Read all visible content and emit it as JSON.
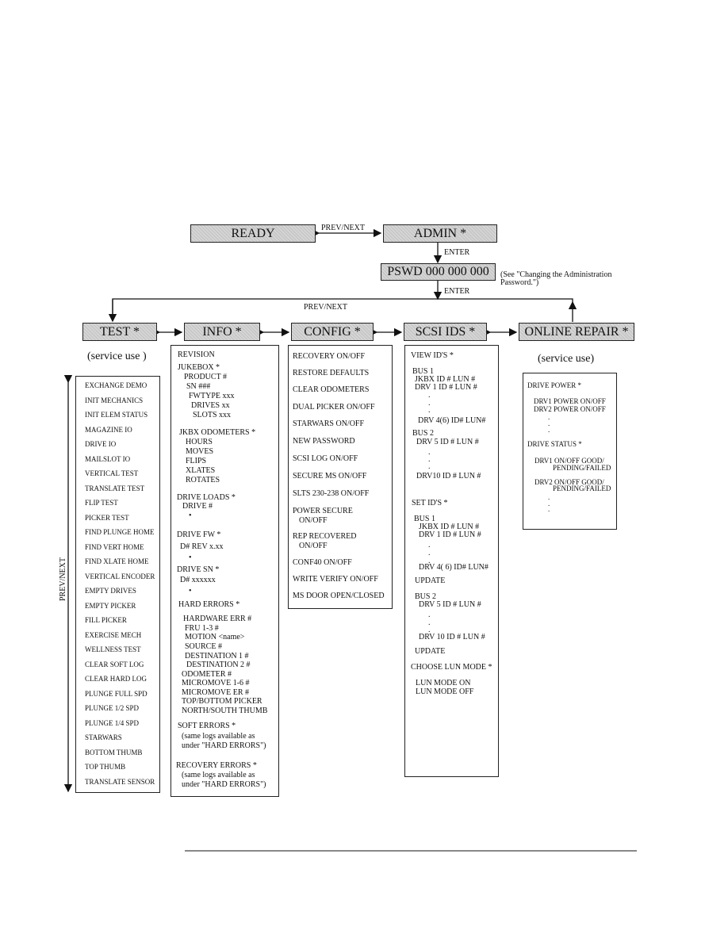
{
  "top": {
    "ready": "READY",
    "admin": "ADMIN *",
    "prev_next_top": "PREV/NEXT",
    "enter_1": "ENTER",
    "pswd": "PSWD 000 000 000",
    "pswd_note_1": "(See \"Changing the Administration",
    "pswd_note_2": "Password.\")",
    "enter_2": "ENTER",
    "prev_next_row": "PREV/NEXT",
    "prev_next_side": "PREV/NEXT"
  },
  "menus": {
    "test": "TEST *",
    "info": "INFO *",
    "config": "CONFIG *",
    "scsi": "SCSI IDS *",
    "online": "ONLINE REPAIR *"
  },
  "test_note": "(service use )",
  "online_note": "(service use)",
  "test_items": [
    "EXCHANGE DEMO",
    "INIT MECHANICS",
    "INIT ELEM STATUS",
    "MAGAZINE IO",
    "DRIVE IO",
    "MAILSLOT IO",
    "VERTICAL TEST",
    "TRANSLATE TEST",
    "FLIP TEST",
    "PICKER TEST",
    "FIND PLUNGE HOME",
    "FIND VERT HOME",
    "FIND XLATE HOME",
    "VERTICAL ENCODER",
    "EMPTY DRIVES",
    "EMPTY  PICKER",
    "FILL PICKER",
    "EXERCISE MECH",
    "WELLNESS TEST",
    "CLEAR SOFT LOG",
    "CLEAR HARD LOG",
    "PLUNGE FULL SPD",
    "PLUNGE 1/2 SPD",
    "PLUNGE 1/4 SPD",
    "STARWARS",
    "BOTTOM THUMB",
    "TOP THUMB",
    "TRANSLATE SENSOR"
  ],
  "info_items": [
    "REVISION",
    "JUKEBOX *",
    "PRODUCT #",
    "SN ###",
    "FWTYPE xxx",
    "DRIVES xx",
    "SLOTS xxx",
    "JKBX ODOMETERS *",
    "HOURS",
    "MOVES",
    "FLIPS",
    "XLATES",
    "ROTATES",
    "DRIVE LOADS *",
    "DRIVE #",
    "•",
    "DRIVE FW *",
    "D# REV x.xx",
    "•",
    "DRIVE SN *",
    "D# xxxxxx",
    "•",
    "HARD ERRORS *",
    "HARDWARE ERR #",
    "FRU 1-3 #",
    "MOTION <name>",
    "SOURCE #",
    "DESTINATION 1 #",
    "DESTINATION 2 #",
    "ODOMETER #",
    "MICROMOVE 1-6 #",
    "MICROMOVE ER #",
    "TOP/BOTTOM PICKER",
    "NORTH/SOUTH THUMB",
    "SOFT ERRORS *",
    "(same logs available as",
    "under \"HARD ERRORS\")",
    "RECOVERY ERRORS *",
    "(same logs available as",
    "under \"HARD ERRORS\")"
  ],
  "config_items": [
    "RECOVERY ON/OFF",
    "RESTORE DEFAULTS",
    "CLEAR ODOMETERS",
    "DUAL PICKER ON/OFF",
    "STARWARS ON/OFF",
    "NEW PASSWORD",
    "SCSI LOG ON/OFF",
    "SECURE  MS ON/OFF",
    "SLTS 230-238 ON/OFF",
    "POWER SECURE",
    "ON/OFF",
    "REP RECOVERED",
    "ON/OFF",
    "CONF40 ON/OFF",
    "WRITE VERIFY ON/OFF",
    "MS DOOR OPEN/CLOSED"
  ],
  "scsi_items": [
    "VIEW ID'S *",
    "BUS 1",
    "JKBX ID # LUN #",
    "DRV 1 ID # LUN #",
    ".",
    ".",
    ".",
    "DRV 4(6) ID# LUN#",
    "BUS 2",
    "DRV 5 ID # LUN #",
    ".",
    ".",
    ".",
    "DRV10 ID # LUN #",
    "SET ID'S  *",
    "BUS 1",
    "JKBX ID # LUN #",
    "DRV 1 ID # LUN #",
    ".",
    ".",
    ".",
    "DRV 4( 6) ID# LUN#",
    "UPDATE",
    "BUS 2",
    "DRV 5 ID # LUN #",
    ".",
    ".",
    ".",
    "DRV 10 ID # LUN #",
    "UPDATE",
    "CHOOSE LUN MODE *",
    "LUN MODE ON",
    "LUN MODE OFF"
  ],
  "online_items": [
    "DRIVE POWER *",
    "DRV1 POWER ON/OFF",
    "DRV2 POWER ON/OFF",
    ".",
    ".",
    ".",
    "DRIVE STATUS *",
    "DRV1  ON/OFF  GOOD/",
    "PENDING/FAILED",
    "DRV2   ON/OFF  GOOD/",
    "PENDING/FAILED",
    ".",
    ".",
    "."
  ]
}
